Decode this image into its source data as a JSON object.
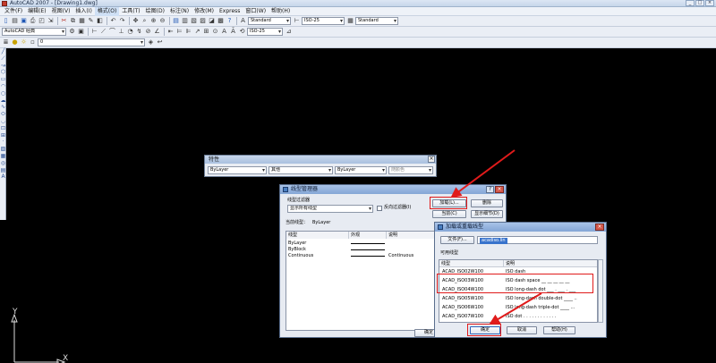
{
  "titlebar": {
    "title": "AutoCAD 2007 - [Drawing1.dwg]",
    "buttons": [
      "_",
      "□",
      "×"
    ]
  },
  "menubar": [
    "文件(F)",
    "编辑(E)",
    "视图(V)",
    "插入(I)",
    "格式(O)",
    "工具(T)",
    "绘图(D)",
    "标注(N)",
    "修改(M)",
    "Express",
    "窗口(W)",
    "帮助(H)"
  ],
  "toolbar1": {
    "text_style": "Standard",
    "dim_style": "ISO-25",
    "table_style": "Standard"
  },
  "toolbar2": {
    "workspace": "AutoCAD 经典",
    "dim_style2": "ISO-25"
  },
  "toolbar3": {
    "layer": "0"
  },
  "ucs": {
    "y": "Y",
    "x": "X"
  },
  "properties_bar": {
    "title": "特性",
    "color": "ByLayer",
    "linetype_mid": "其他",
    "linetype": "ByLayer",
    "plotstyle": "随颜色"
  },
  "linetype_manager": {
    "title": "线型管理器",
    "filter_label": "线型过滤器",
    "filter_value": "显示所有线型",
    "invert_filter": "反向过滤器(I)",
    "load_button": "加载(L)...",
    "delete_button": "删除",
    "current_button": "当前(C)",
    "details_button": "显示细节(D)",
    "current_linetype_label": "当前线型：",
    "current_linetype_value": "ByLayer",
    "columns": [
      "线型",
      "外观",
      "说明"
    ],
    "rows": [
      {
        "name": "ByLayer",
        "desc": ""
      },
      {
        "name": "ByBlock",
        "desc": ""
      },
      {
        "name": "Continuous",
        "desc": "Continuous"
      }
    ],
    "ok_button": "确定"
  },
  "load_dialog": {
    "title": "加载或重载线型",
    "file_button": "文件(F)...",
    "file_value": "acadiso.lin",
    "available_label": "可用线型",
    "columns": [
      "线型",
      "说明"
    ],
    "rows": [
      {
        "name": "ACAD_ISO02W100",
        "desc": "ISO dash __ __ __ __ __ __ __ __"
      },
      {
        "name": "ACAD_ISO03W100",
        "desc": "ISO dash space __ __ __ __ __"
      },
      {
        "name": "ACAD_ISO04W100",
        "desc": "ISO long-dash dot ___ . ___ . ___"
      },
      {
        "name": "ACAD_ISO05W100",
        "desc": "ISO long-dash double-dot ____ .."
      },
      {
        "name": "ACAD_ISO06W100",
        "desc": "ISO long-dash triple-dot ____ ..."
      },
      {
        "name": "ACAD_ISO07W100",
        "desc": "ISO dot . . . . . . . . . . . ."
      }
    ],
    "ok_button": "确定",
    "cancel_button": "取消",
    "help_button": "帮助(H)"
  },
  "annotation_color": "#e01b1b"
}
